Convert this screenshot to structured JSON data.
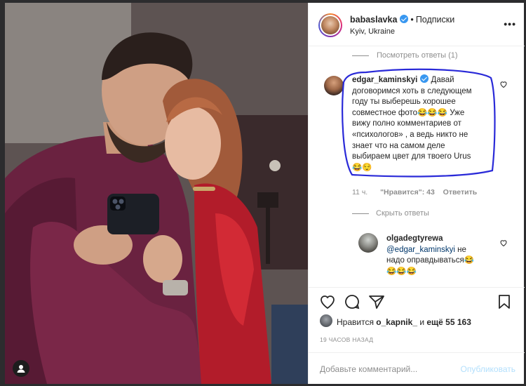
{
  "post": {
    "author": "babaslavka",
    "follow_label": "Подписки",
    "location": "Kyiv, Ukraine",
    "more_label": "•••"
  },
  "comments": {
    "view_replies_top": "Посмотреть ответы (1)",
    "main": {
      "user": "edgar_kaminskyi",
      "lines": [
        "Давай",
        "договоримся хоть в следующем",
        "году ты выберешь хорошее",
        "совместное фото😂😂😂 Уже",
        "вижу полно комментариев от",
        "«психологов» , а ведь никто не",
        "знает что на самом деле",
        "выбираем цвет для твоего Urus",
        "😂😌"
      ],
      "time": "11 ч.",
      "likes_label": "\"Нравится\": 43",
      "reply_label": "Ответить"
    },
    "hide_replies": "Скрыть ответы",
    "reply": {
      "user": "olgadegtyrewa",
      "mention": "@edgar_kaminskyi",
      "line1_rest": " не",
      "line2": "надо оправдываться😂",
      "line3": "😂😂😂"
    }
  },
  "likes": {
    "prefix": "Нравится ",
    "user": "o_kapnik_",
    "middle": " и ",
    "count": "ещё 55 163"
  },
  "time_ago": "19 ЧАСОВ НАЗАД",
  "add_comment": {
    "placeholder": "Добавьте комментарий...",
    "post_label": "Опубликовать"
  },
  "colors": {
    "verified": "#3897f0",
    "annotation": "#2a2ad8",
    "link": "#00376b",
    "post_disabled": "#b2dffc"
  }
}
